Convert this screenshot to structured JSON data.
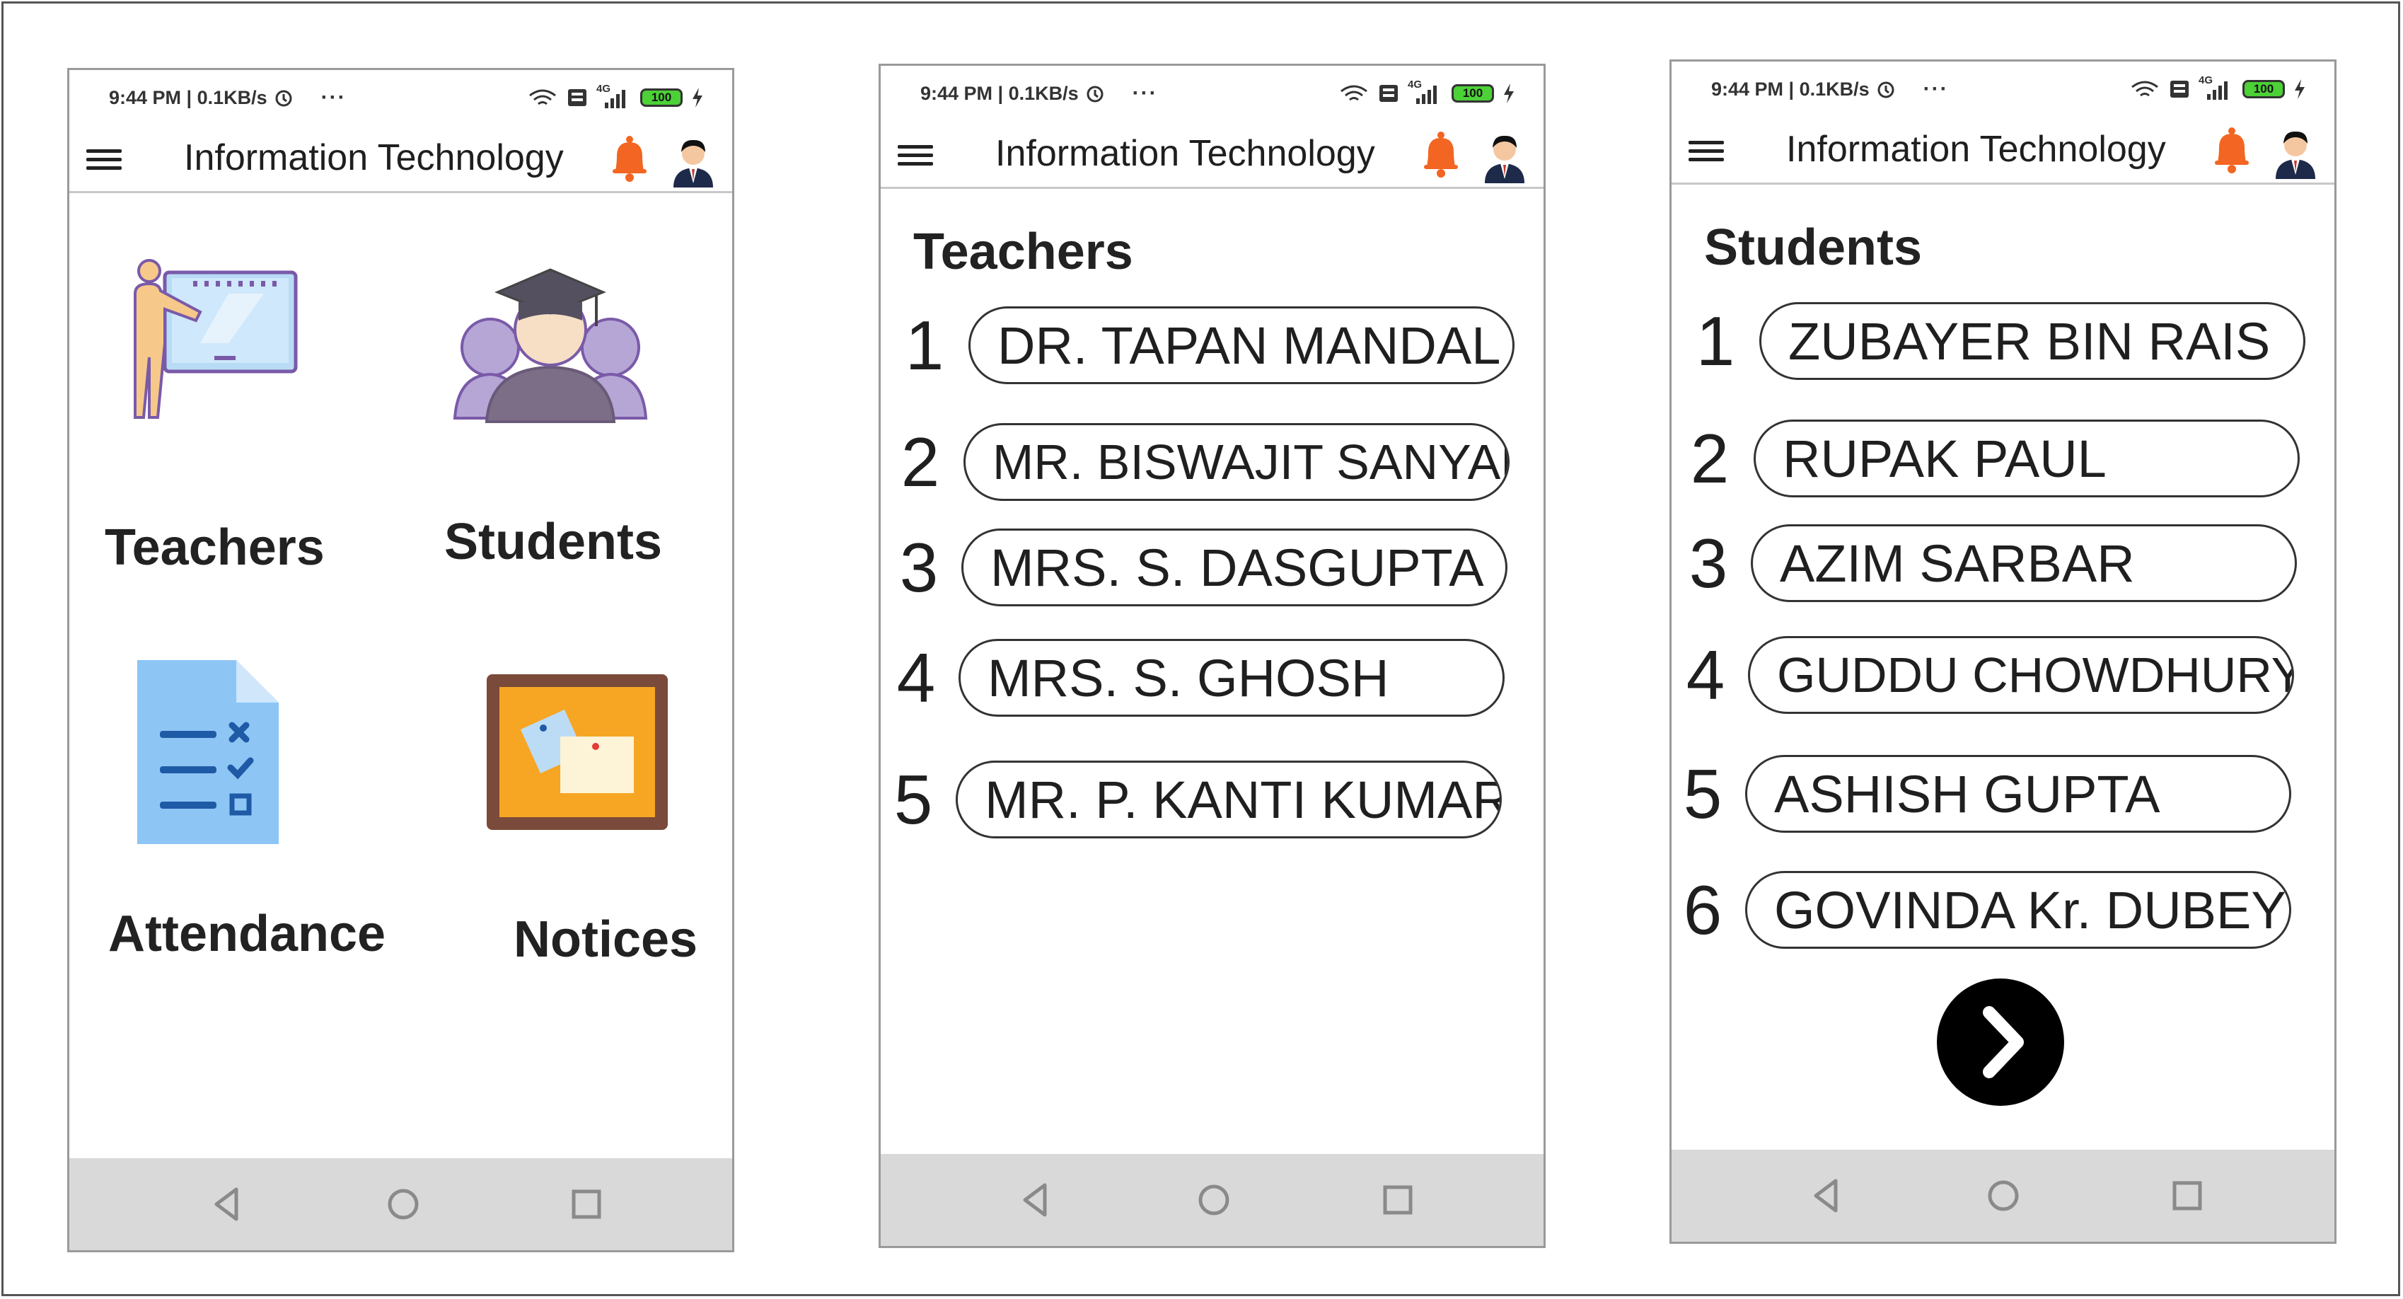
{
  "colors": {
    "accent_bell": "#f26522",
    "nav_bar": "#d9d9d9",
    "pill_border": "#333333",
    "next_button": "#000000"
  },
  "status_bar": {
    "time": "9:44 PM | 0.1KB/s",
    "dots": "···",
    "network_label": "4G",
    "battery": "100",
    "icons": [
      "alarm-icon",
      "wifi-icon",
      "volte-icon",
      "signal-icon",
      "battery-icon",
      "charging-icon"
    ]
  },
  "app_bar": {
    "title": "Information Technology",
    "icons": [
      "menu-icon",
      "bell-icon",
      "avatar-icon"
    ]
  },
  "nav_bar": {
    "icons": [
      "back-icon",
      "home-icon",
      "recents-icon"
    ]
  },
  "screens": {
    "home": {
      "tiles": [
        {
          "label": "Teachers",
          "icon": "teacher-icon"
        },
        {
          "label": "Students",
          "icon": "graduate-icon"
        },
        {
          "label": "Attendance",
          "icon": "checklist-icon"
        },
        {
          "label": "Notices",
          "icon": "notice-board-icon"
        }
      ]
    },
    "teachers": {
      "title": "Teachers",
      "items": [
        {
          "num": "1",
          "name": "DR. TAPAN MANDAL"
        },
        {
          "num": "2",
          "name": "MR. BISWAJIT SANYAL"
        },
        {
          "num": "3",
          "name": "MRS. S. DASGUPTA"
        },
        {
          "num": "4",
          "name": "MRS. S. GHOSH"
        },
        {
          "num": "5",
          "name": "MR. P. KANTI KUMAR"
        }
      ]
    },
    "students": {
      "title": "Students",
      "items": [
        {
          "num": "1",
          "name": "ZUBAYER BIN RAIS"
        },
        {
          "num": "2",
          "name": "RUPAK PAUL"
        },
        {
          "num": "3",
          "name": "AZIM SARBAR"
        },
        {
          "num": "4",
          "name": "GUDDU CHOWDHURY"
        },
        {
          "num": "5",
          "name": "ASHISH GUPTA"
        },
        {
          "num": "6",
          "name": "GOVINDA Kr. DUBEY"
        }
      ],
      "next_icon": "chevron-right-icon"
    }
  }
}
